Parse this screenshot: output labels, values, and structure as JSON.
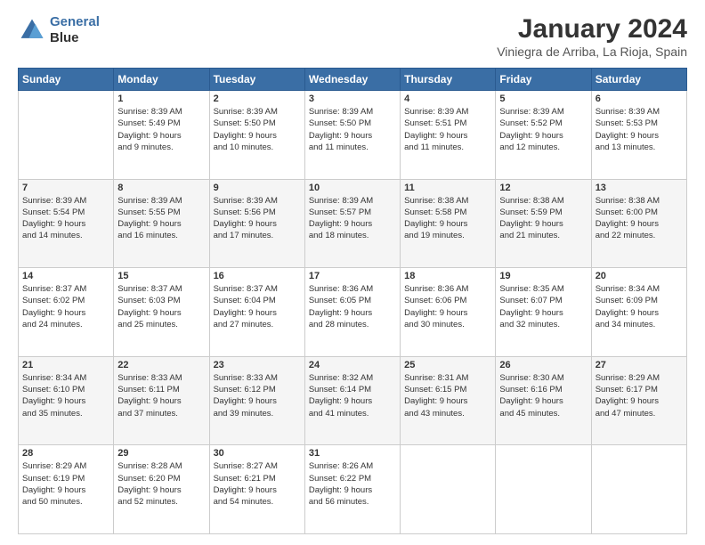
{
  "logo": {
    "line1": "General",
    "line2": "Blue"
  },
  "title": "January 2024",
  "location": "Viniegra de Arriba, La Rioja, Spain",
  "weekdays": [
    "Sunday",
    "Monday",
    "Tuesday",
    "Wednesday",
    "Thursday",
    "Friday",
    "Saturday"
  ],
  "weeks": [
    [
      {
        "day": "",
        "info": ""
      },
      {
        "day": "1",
        "info": "Sunrise: 8:39 AM\nSunset: 5:49 PM\nDaylight: 9 hours\nand 9 minutes."
      },
      {
        "day": "2",
        "info": "Sunrise: 8:39 AM\nSunset: 5:50 PM\nDaylight: 9 hours\nand 10 minutes."
      },
      {
        "day": "3",
        "info": "Sunrise: 8:39 AM\nSunset: 5:50 PM\nDaylight: 9 hours\nand 11 minutes."
      },
      {
        "day": "4",
        "info": "Sunrise: 8:39 AM\nSunset: 5:51 PM\nDaylight: 9 hours\nand 11 minutes."
      },
      {
        "day": "5",
        "info": "Sunrise: 8:39 AM\nSunset: 5:52 PM\nDaylight: 9 hours\nand 12 minutes."
      },
      {
        "day": "6",
        "info": "Sunrise: 8:39 AM\nSunset: 5:53 PM\nDaylight: 9 hours\nand 13 minutes."
      }
    ],
    [
      {
        "day": "7",
        "info": "Sunrise: 8:39 AM\nSunset: 5:54 PM\nDaylight: 9 hours\nand 14 minutes."
      },
      {
        "day": "8",
        "info": "Sunrise: 8:39 AM\nSunset: 5:55 PM\nDaylight: 9 hours\nand 16 minutes."
      },
      {
        "day": "9",
        "info": "Sunrise: 8:39 AM\nSunset: 5:56 PM\nDaylight: 9 hours\nand 17 minutes."
      },
      {
        "day": "10",
        "info": "Sunrise: 8:39 AM\nSunset: 5:57 PM\nDaylight: 9 hours\nand 18 minutes."
      },
      {
        "day": "11",
        "info": "Sunrise: 8:38 AM\nSunset: 5:58 PM\nDaylight: 9 hours\nand 19 minutes."
      },
      {
        "day": "12",
        "info": "Sunrise: 8:38 AM\nSunset: 5:59 PM\nDaylight: 9 hours\nand 21 minutes."
      },
      {
        "day": "13",
        "info": "Sunrise: 8:38 AM\nSunset: 6:00 PM\nDaylight: 9 hours\nand 22 minutes."
      }
    ],
    [
      {
        "day": "14",
        "info": "Sunrise: 8:37 AM\nSunset: 6:02 PM\nDaylight: 9 hours\nand 24 minutes."
      },
      {
        "day": "15",
        "info": "Sunrise: 8:37 AM\nSunset: 6:03 PM\nDaylight: 9 hours\nand 25 minutes."
      },
      {
        "day": "16",
        "info": "Sunrise: 8:37 AM\nSunset: 6:04 PM\nDaylight: 9 hours\nand 27 minutes."
      },
      {
        "day": "17",
        "info": "Sunrise: 8:36 AM\nSunset: 6:05 PM\nDaylight: 9 hours\nand 28 minutes."
      },
      {
        "day": "18",
        "info": "Sunrise: 8:36 AM\nSunset: 6:06 PM\nDaylight: 9 hours\nand 30 minutes."
      },
      {
        "day": "19",
        "info": "Sunrise: 8:35 AM\nSunset: 6:07 PM\nDaylight: 9 hours\nand 32 minutes."
      },
      {
        "day": "20",
        "info": "Sunrise: 8:34 AM\nSunset: 6:09 PM\nDaylight: 9 hours\nand 34 minutes."
      }
    ],
    [
      {
        "day": "21",
        "info": "Sunrise: 8:34 AM\nSunset: 6:10 PM\nDaylight: 9 hours\nand 35 minutes."
      },
      {
        "day": "22",
        "info": "Sunrise: 8:33 AM\nSunset: 6:11 PM\nDaylight: 9 hours\nand 37 minutes."
      },
      {
        "day": "23",
        "info": "Sunrise: 8:33 AM\nSunset: 6:12 PM\nDaylight: 9 hours\nand 39 minutes."
      },
      {
        "day": "24",
        "info": "Sunrise: 8:32 AM\nSunset: 6:14 PM\nDaylight: 9 hours\nand 41 minutes."
      },
      {
        "day": "25",
        "info": "Sunrise: 8:31 AM\nSunset: 6:15 PM\nDaylight: 9 hours\nand 43 minutes."
      },
      {
        "day": "26",
        "info": "Sunrise: 8:30 AM\nSunset: 6:16 PM\nDaylight: 9 hours\nand 45 minutes."
      },
      {
        "day": "27",
        "info": "Sunrise: 8:29 AM\nSunset: 6:17 PM\nDaylight: 9 hours\nand 47 minutes."
      }
    ],
    [
      {
        "day": "28",
        "info": "Sunrise: 8:29 AM\nSunset: 6:19 PM\nDaylight: 9 hours\nand 50 minutes."
      },
      {
        "day": "29",
        "info": "Sunrise: 8:28 AM\nSunset: 6:20 PM\nDaylight: 9 hours\nand 52 minutes."
      },
      {
        "day": "30",
        "info": "Sunrise: 8:27 AM\nSunset: 6:21 PM\nDaylight: 9 hours\nand 54 minutes."
      },
      {
        "day": "31",
        "info": "Sunrise: 8:26 AM\nSunset: 6:22 PM\nDaylight: 9 hours\nand 56 minutes."
      },
      {
        "day": "",
        "info": ""
      },
      {
        "day": "",
        "info": ""
      },
      {
        "day": "",
        "info": ""
      }
    ]
  ]
}
